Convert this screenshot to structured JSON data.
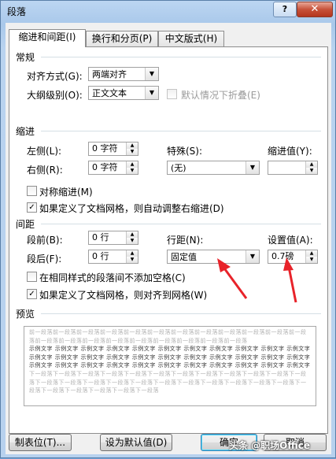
{
  "window": {
    "title": "段落",
    "help": "?",
    "close": "✕"
  },
  "tabs": [
    {
      "label": "缩进和间距(I)"
    },
    {
      "label": "换行和分页(P)"
    },
    {
      "label": "中文版式(H)"
    }
  ],
  "general": {
    "section": "常规",
    "alignment_label": "对齐方式(G):",
    "alignment_value": "两端对齐",
    "outline_label": "大纲级别(O):",
    "outline_value": "正文文本",
    "collapse_label": "默认情况下折叠(E)"
  },
  "indent": {
    "section": "缩进",
    "left_label": "左侧(L):",
    "left_value": "0 字符",
    "right_label": "右侧(R):",
    "right_value": "0 字符",
    "special_label": "特殊(S):",
    "special_value": "(无)",
    "amount_label": "缩进值(Y):",
    "amount_value": "",
    "mirror_label": "对称缩进(M)",
    "auto_adjust_label": "如果定义了文档网格，则自动调整右缩进(D)"
  },
  "spacing": {
    "section": "间距",
    "before_label": "段前(B):",
    "before_value": "0 行",
    "after_label": "段后(F):",
    "after_value": "0 行",
    "line_label": "行距(N):",
    "line_value": "固定值",
    "at_label": "设置值(A):",
    "at_value": "0.7磅",
    "no_space_label": "在相同样式的段落间不添加空格(C)",
    "snap_grid_label": "如果定义了文档网格，则对齐到网格(W)"
  },
  "preview": {
    "section": "预览",
    "prev_text": "前一段落前一段落前一段落前一段落前一段落前一段落前一段落前一段落前一段落前一段落前一段落前一段落前一段落前一段落前一段落前一段落前一段落前一段落前一段落前一段落前一段落",
    "sample_text": "示例文字 示例文字 示例文字 示例文字 示例文字 示例文字 示例文字 示例文字 示例文字 示例文字 示例文字 示例文字 示例文字 示例文字 示例文字 示例文字 示例文字 示例文字 示例文字 示例文字 示例文字 示例文字 示例文字 示例文字 示例文字 示例文字 示例文字 示例文字 示例文字 示例文字 示例文字 示例文字 示例文字",
    "next_text": "下一段落下一段落下一段落下一段落下一段落下一段落下一段落下一段落下一段落下一段落下一段落下一段落下一段落下一段落下一段落下一段落下一段落下一段落下一段落下一段落下一段落下一段落下一段落下一段落下一段落下一段落下一段落下一段落下一段落"
  },
  "buttons": {
    "tabs": "制表位(T)...",
    "default": "设为默认值(D)",
    "ok": "确定",
    "cancel": "取消"
  },
  "watermark": "头条 @职场Office",
  "colors": {
    "arrow": "#e8232a",
    "accent": "#3c7fb1"
  }
}
